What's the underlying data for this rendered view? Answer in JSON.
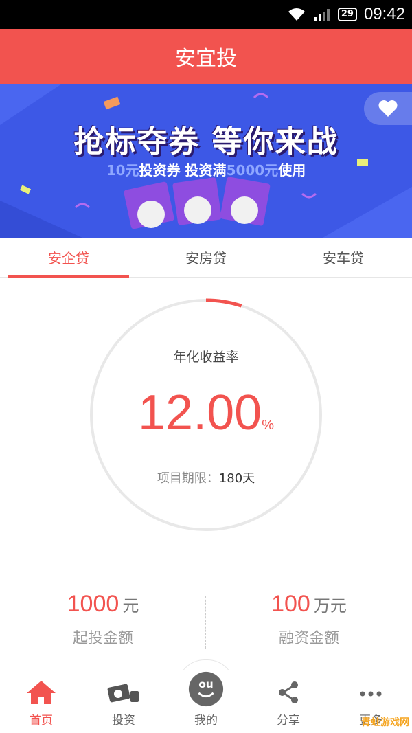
{
  "status_bar": {
    "time": "09:42",
    "battery": "29"
  },
  "header": {
    "title": "安宜投"
  },
  "banner": {
    "title": "抢标夺券 等你来战",
    "sub_amount": "10元",
    "sub_text_1": "投资券 投资满",
    "sub_threshold": "5000元",
    "sub_text_2": "使用"
  },
  "tabs": [
    {
      "label": "安企贷",
      "active": true
    },
    {
      "label": "安房贷",
      "active": false
    },
    {
      "label": "安车贷",
      "active": false
    }
  ],
  "rate": {
    "label": "年化收益率",
    "value": "12.00",
    "unit": "%",
    "progress": 0.05,
    "term_label": "项目期限：",
    "term_value": "180天"
  },
  "stats": [
    {
      "amount": "1000",
      "unit": "元",
      "label": "起投金额"
    },
    {
      "amount": "100",
      "unit": "万元",
      "label": "融资金额"
    }
  ],
  "nav": [
    {
      "label": "首页",
      "icon": "home-icon",
      "active": true
    },
    {
      "label": "投资",
      "icon": "invest-icon",
      "active": false
    },
    {
      "label": "我的",
      "icon": "profile-icon",
      "active": false
    },
    {
      "label": "分享",
      "icon": "share-icon",
      "active": false
    },
    {
      "label": "更多",
      "icon": "more-icon",
      "active": false
    }
  ],
  "watermark": "青蛙游戏网",
  "colors": {
    "primary": "#f2534f",
    "banner": "#3d58e6"
  }
}
